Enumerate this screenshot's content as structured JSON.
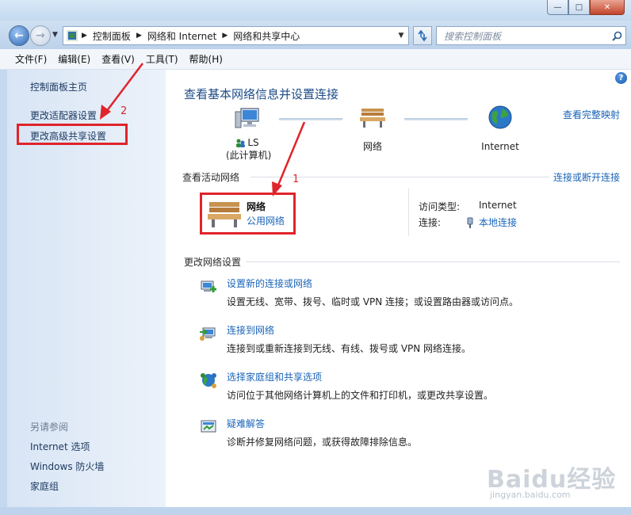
{
  "window": {
    "minimize": "—",
    "maximize": "□",
    "close": "✕"
  },
  "nav": {
    "back_glyph": "←",
    "forward_glyph": "→",
    "breadcrumb": [
      "控制面板",
      "网络和 Internet",
      "网络和共享中心"
    ],
    "search_placeholder": "搜索控制面板"
  },
  "menu": [
    "文件(F)",
    "编辑(E)",
    "查看(V)",
    "工具(T)",
    "帮助(H)"
  ],
  "sidebar": {
    "home": "控制面板主页",
    "adapter": "更改适配器设置",
    "advanced": "更改高级共享设置",
    "see_also": "另请参阅",
    "see_also_items": [
      "Internet 选项",
      "Windows 防火墙",
      "家庭组"
    ]
  },
  "main": {
    "help": "?",
    "title": "查看基本网络信息并设置连接",
    "full_map": "查看完整映射",
    "map": {
      "computer_name": "LS",
      "computer_sub": "(此计算机)",
      "network": "网络",
      "internet": "Internet"
    },
    "active_networks_header": "查看活动网络",
    "connect_disconnect": "连接或断开连接",
    "active_network": {
      "name": "网络",
      "type": "公用网络",
      "access_type_label": "访问类型:",
      "access_type_value": "Internet",
      "connection_label": "连接:",
      "connection_value": "本地连接"
    },
    "change_settings_header": "更改网络设置",
    "tasks": [
      {
        "title": "设置新的连接或网络",
        "desc": "设置无线、宽带、拨号、临时或 VPN 连接；或设置路由器或访问点。",
        "icon": "new-connection-icon"
      },
      {
        "title": "连接到网络",
        "desc": "连接到或重新连接到无线、有线、拨号或 VPN 网络连接。",
        "icon": "connect-network-icon"
      },
      {
        "title": "选择家庭组和共享选项",
        "desc": "访问位于其他网络计算机上的文件和打印机，或更改共享设置。",
        "icon": "homegroup-icon"
      },
      {
        "title": "疑难解答",
        "desc": "诊断并修复网络问题，或获得故障排除信息。",
        "icon": "troubleshoot-icon"
      }
    ]
  },
  "annotations": {
    "one": "1",
    "two": "2"
  },
  "watermark": {
    "brand": "Baidu经验",
    "url": "jingyan.baidu.com"
  },
  "colors": {
    "link": "#1a64b8",
    "annotation": "#e0242b",
    "sidebar": "#d8e5f5"
  }
}
